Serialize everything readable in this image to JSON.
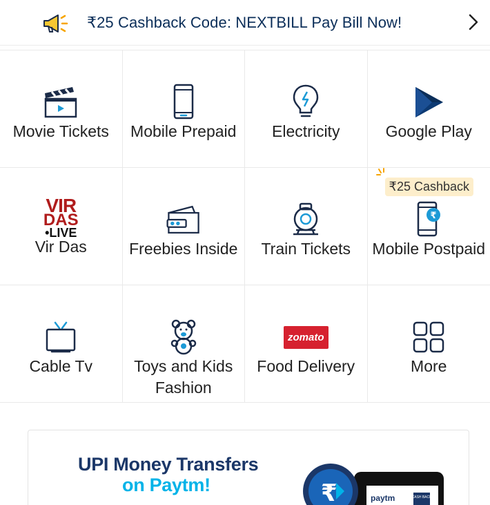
{
  "promo": {
    "text": "₹25 Cashback Code: NEXTBILL Pay Bill Now!",
    "icon": "megaphone-icon",
    "chevron": "chevron-right-icon"
  },
  "services": [
    {
      "label": "Movie Tickets",
      "icon": "clapperboard-icon"
    },
    {
      "label": "Mobile Prepaid",
      "icon": "smartphone-icon"
    },
    {
      "label": "Electricity",
      "icon": "bulb-icon"
    },
    {
      "label": "Google Play",
      "icon": "google-play-icon"
    },
    {
      "label": "Vir Das",
      "icon": "vir-das-live-logo",
      "logo_lines": [
        "VIR",
        "DAS",
        "•LIVE"
      ]
    },
    {
      "label": "Freebies Inside",
      "icon": "wallet-icon"
    },
    {
      "label": "Train Tickets",
      "icon": "train-icon"
    },
    {
      "label": "Mobile Postpaid",
      "icon": "phone-rupee-icon",
      "badge": "₹25 Cashback"
    },
    {
      "label": "Cable Tv",
      "icon": "tv-icon"
    },
    {
      "label": "Toys and Kids Fashion",
      "icon": "teddy-bear-icon"
    },
    {
      "label": "Food Delivery",
      "icon": "zomato-logo",
      "logo_text": "zomato"
    },
    {
      "label": "More",
      "icon": "grid-icon"
    }
  ],
  "banner": {
    "title": "UPI Money Transfers",
    "subtitle": "on Paytm!",
    "art_text": "paytm",
    "art_tag": "CASH BACK"
  },
  "colors": {
    "primary_navy": "#0b2e59",
    "icon_blue": "#1565c0",
    "accent_cyan": "#00b3e8",
    "badge_bg": "#fdeecb",
    "zomato_red": "#d6212f",
    "vir_das_red": "#b01c1c"
  }
}
